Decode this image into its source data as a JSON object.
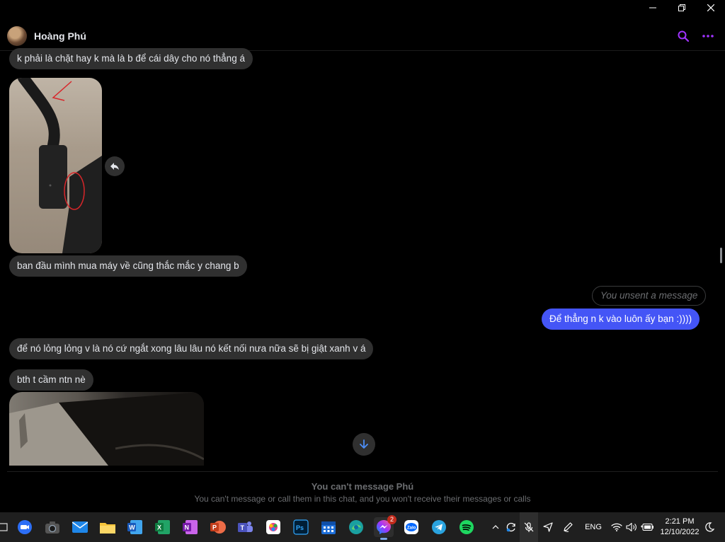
{
  "window": {
    "controls": [
      "minimize",
      "restore",
      "close"
    ]
  },
  "header": {
    "contact_name": "Hoàng Phú",
    "icons": [
      "search-icon",
      "more-icon"
    ],
    "accent": "#a033ff"
  },
  "messages": [
    {
      "from": "them",
      "type": "text",
      "text": "k phải là chặt hay k mà là b để cái dây cho nó thẳng á"
    },
    {
      "from": "them",
      "type": "image",
      "description_icon": "photo"
    },
    {
      "from": "them",
      "type": "text",
      "text": "ban đầu mình mua máy về cũng thắc mắc y chang b"
    },
    {
      "from": "me",
      "type": "unsent",
      "text": "You unsent a message"
    },
    {
      "from": "me",
      "type": "text",
      "text": "Để thẳng n k vào luôn ấy bạn :))))"
    },
    {
      "from": "them",
      "type": "text",
      "text": "để nó lỏng lỏng v là nó cứ ngắt xong lâu lâu nó kết nối nưa nữa sẽ bị giật xanh v á"
    },
    {
      "from": "them",
      "type": "text",
      "text": "bth t cầm ntn nè"
    },
    {
      "from": "them",
      "type": "image",
      "description_icon": "photo"
    }
  ],
  "colors": {
    "outgoing_bubble": "#4455f6",
    "incoming_bubble": "#303030",
    "background": "#000000"
  },
  "footer": {
    "title": "You can't message Phú",
    "subtitle": "You can't message or call them in this chat, and you won't receive their messages or calls"
  },
  "taskbar": {
    "apps": [
      "zoom",
      "camera",
      "mail",
      "file-explorer",
      "word",
      "excel",
      "onenote",
      "powerpoint",
      "teams",
      "paint",
      "photoshop",
      "calendar",
      "edge",
      "messenger",
      "zalo",
      "telegram",
      "spotify"
    ],
    "messenger_badge": "2",
    "language": "ENG",
    "time": "2:21 PM",
    "date": "12/10/2022"
  }
}
